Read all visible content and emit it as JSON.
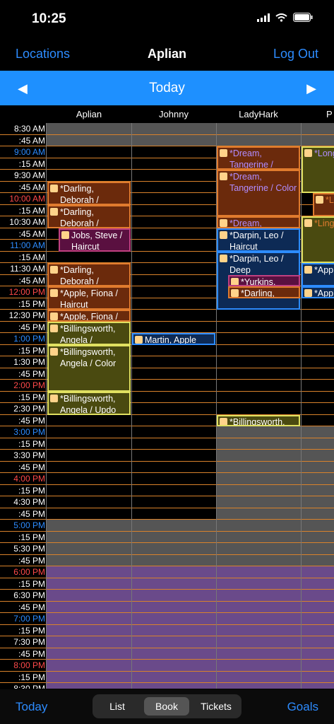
{
  "status": {
    "time": "10:25"
  },
  "nav": {
    "left": "Locations",
    "title": "Aplian",
    "right": "Log Out"
  },
  "datebar": {
    "label": "Today",
    "prev": "◀",
    "next": "▶"
  },
  "columns": [
    "Aplian",
    "Johnny",
    "LadyHark",
    "P"
  ],
  "times": [
    {
      "t": "8:30 AM",
      "c": ""
    },
    {
      "t": ":45 AM",
      "c": ""
    },
    {
      "t": "9:00 AM",
      "c": "blue"
    },
    {
      "t": ":15 AM",
      "c": ""
    },
    {
      "t": "9:30 AM",
      "c": ""
    },
    {
      "t": ":45 AM",
      "c": ""
    },
    {
      "t": "10:00 AM",
      "c": "red"
    },
    {
      "t": ":15 AM",
      "c": ""
    },
    {
      "t": "10:30 AM",
      "c": ""
    },
    {
      "t": ":45 AM",
      "c": ""
    },
    {
      "t": "11:00 AM",
      "c": "blue"
    },
    {
      "t": ":15 AM",
      "c": ""
    },
    {
      "t": "11:30 AM",
      "c": ""
    },
    {
      "t": ":45 AM",
      "c": ""
    },
    {
      "t": "12:00 PM",
      "c": "red"
    },
    {
      "t": ":15 PM",
      "c": ""
    },
    {
      "t": "12:30 PM",
      "c": ""
    },
    {
      "t": ":45 PM",
      "c": ""
    },
    {
      "t": "1:00 PM",
      "c": "blue"
    },
    {
      "t": ":15 PM",
      "c": ""
    },
    {
      "t": "1:30 PM",
      "c": ""
    },
    {
      "t": ":45 PM",
      "c": ""
    },
    {
      "t": "2:00 PM",
      "c": "red"
    },
    {
      "t": ":15 PM",
      "c": ""
    },
    {
      "t": "2:30 PM",
      "c": ""
    },
    {
      "t": ":45 PM",
      "c": ""
    },
    {
      "t": "3:00 PM",
      "c": "blue"
    },
    {
      "t": ":15 PM",
      "c": ""
    },
    {
      "t": "3:30 PM",
      "c": ""
    },
    {
      "t": ":45 PM",
      "c": ""
    },
    {
      "t": "4:00 PM",
      "c": "red"
    },
    {
      "t": ":15 PM",
      "c": ""
    },
    {
      "t": "4:30 PM",
      "c": ""
    },
    {
      "t": ":45 PM",
      "c": ""
    },
    {
      "t": "5:00 PM",
      "c": "blue"
    },
    {
      "t": ":15 PM",
      "c": ""
    },
    {
      "t": "5:30 PM",
      "c": ""
    },
    {
      "t": ":45 PM",
      "c": ""
    },
    {
      "t": "6:00 PM",
      "c": "red"
    },
    {
      "t": ":15 PM",
      "c": ""
    },
    {
      "t": "6:30 PM",
      "c": ""
    },
    {
      "t": ":45 PM",
      "c": ""
    },
    {
      "t": "7:00 PM",
      "c": "blue"
    },
    {
      "t": ":15 PM",
      "c": ""
    },
    {
      "t": "7:30 PM",
      "c": ""
    },
    {
      "t": ":45 PM",
      "c": ""
    },
    {
      "t": "8:00 PM",
      "c": "red"
    },
    {
      "t": ":15 PM",
      "c": ""
    },
    {
      "t": "8:30 PM",
      "c": ""
    }
  ],
  "appointments": [
    {
      "col": 0,
      "start": 5,
      "end": 7,
      "text": "*Darling, Deborah /",
      "bg": "#6b2a0c",
      "border": "#e07b2e",
      "color": "#fff"
    },
    {
      "col": 0,
      "start": 7,
      "end": 9,
      "text": "*Darling, Deborah /",
      "bg": "#6b2a0c",
      "border": "#e07b2e",
      "color": "#fff"
    },
    {
      "col": 0,
      "start": 9,
      "end": 11,
      "text": "Jobs, Steve / Haircut",
      "bg": "#5a1040",
      "border": "#c04080",
      "color": "#fff",
      "indent": 1
    },
    {
      "col": 0,
      "start": 12,
      "end": 14,
      "text": "*Darling, Deborah /",
      "bg": "#6b2a0c",
      "border": "#e07b2e",
      "color": "#fff"
    },
    {
      "col": 0,
      "start": 14,
      "end": 16,
      "text": "*Apple, Fiona / Haircut",
      "bg": "#6b2a0c",
      "border": "#e07b2e",
      "color": "#fff"
    },
    {
      "col": 0,
      "start": 16,
      "end": 17,
      "text": "*Apple, Fiona /",
      "bg": "#6b2a0c",
      "border": "#e07b2e",
      "color": "#fff"
    },
    {
      "col": 0,
      "start": 17,
      "end": 19,
      "text": "*Billingsworth, Angela /",
      "bg": "#4a4a10",
      "border": "#e0e060",
      "color": "#fff"
    },
    {
      "col": 0,
      "start": 19,
      "end": 23,
      "text": "*Billingsworth, Angela / Color",
      "bg": "#4a4a10",
      "border": "#e0e060",
      "color": "#fff"
    },
    {
      "col": 0,
      "start": 23,
      "end": 25,
      "text": "*Billingsworth, Angela / Updo",
      "bg": "#4a4a10",
      "border": "#e0e060",
      "color": "#fff"
    },
    {
      "col": 1,
      "start": 18,
      "end": 19,
      "text": "Martin, Apple",
      "bg": "#0d2a55",
      "border": "#2d8cff",
      "color": "#fff"
    },
    {
      "col": 2,
      "start": 2,
      "end": 4,
      "text": "*Dream, Tangerine /",
      "bg": "#6b2a0c",
      "border": "#e07b2e",
      "color": "#b08cff"
    },
    {
      "col": 2,
      "start": 4,
      "end": 8,
      "text": "*Dream, Tangerine / Color",
      "bg": "#6b2a0c",
      "border": "#e07b2e",
      "color": "#b08cff"
    },
    {
      "col": 2,
      "start": 8,
      "end": 9,
      "text": "*Dream,",
      "bg": "#6b2a0c",
      "border": "#e07b2e",
      "color": "#b08cff"
    },
    {
      "col": 2,
      "start": 9,
      "end": 11,
      "text": "*Darpin, Leo / Haircut",
      "bg": "#0d2a55",
      "border": "#2d8cff",
      "color": "#fff"
    },
    {
      "col": 2,
      "start": 11,
      "end": 16,
      "text": "*Darpin, Leo / Deep",
      "bg": "#0d2a55",
      "border": "#2d8cff",
      "color": "#fff"
    },
    {
      "col": 2,
      "start": 13,
      "end": 14,
      "text": "*Yurkins,",
      "bg": "#5a1040",
      "border": "#c04080",
      "color": "#fff",
      "indent": 1
    },
    {
      "col": 2,
      "start": 14,
      "end": 15,
      "text": "*Darling,",
      "bg": "#6b2a0c",
      "border": "#e07b2e",
      "color": "#fff",
      "indent": 1
    },
    {
      "col": 2,
      "start": 25,
      "end": 26,
      "text": "*Billingsworth,",
      "bg": "#4a4a10",
      "border": "#e0e060",
      "color": "#fff"
    },
    {
      "col": 3,
      "start": 2,
      "end": 6,
      "text": "*Long, P Exter",
      "bg": "#4a4a10",
      "border": "#e0e060",
      "color": "#b08cff"
    },
    {
      "col": 3,
      "start": 6,
      "end": 8,
      "text": "*L He",
      "bg": "#6b2a0c",
      "border": "#e07b2e",
      "color": "#e07b2e",
      "indent": 1
    },
    {
      "col": 3,
      "start": 8,
      "end": 12,
      "text": "*Ling Heat",
      "bg": "#4a4a10",
      "border": "#e0e060",
      "color": "#e07b2e"
    },
    {
      "col": 3,
      "start": 12,
      "end": 14,
      "text": "*App Chris",
      "bg": "#0d2a55",
      "border": "#2d8cff",
      "color": "#fff"
    },
    {
      "col": 3,
      "start": 14,
      "end": 15,
      "text": "*App",
      "bg": "#0d2a55",
      "border": "#2d8cff",
      "color": "#fff"
    }
  ],
  "tabbar": {
    "left": "Today",
    "right": "Goals",
    "segments": [
      "List",
      "Book",
      "Tickets"
    ],
    "selected": 1
  }
}
